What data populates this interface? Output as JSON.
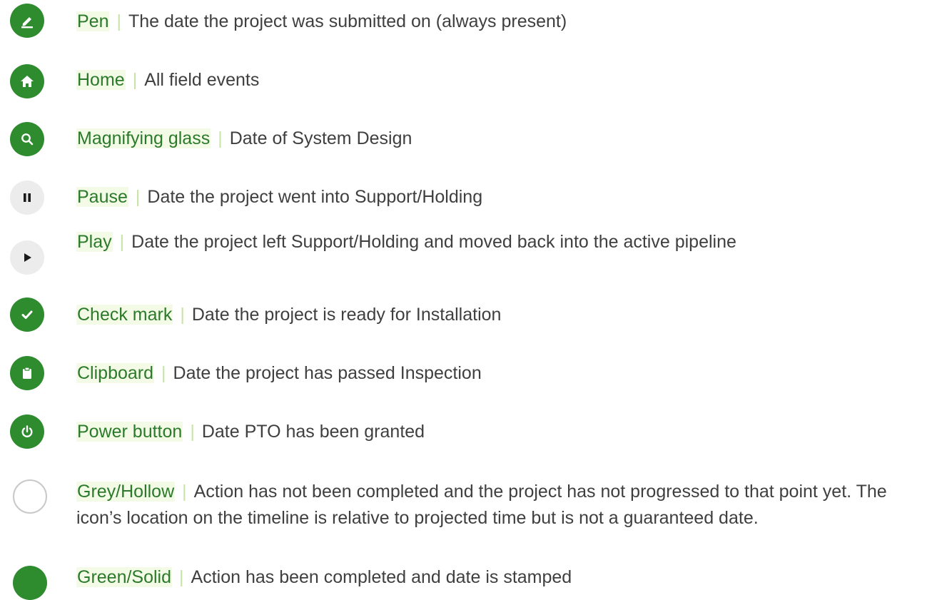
{
  "colors": {
    "accent_green": "#2e8b2e",
    "term_text": "#2b7a2b",
    "term_highlight": "#f3fbe6",
    "separator": "#c7e3a5",
    "body_text": "#3f3f3f",
    "grey_icon_bg": "#ececec",
    "hollow_border": "#c9c9c9"
  },
  "separator": "|",
  "legend": [
    {
      "icon": "pen-icon",
      "term": "Pen",
      "description": "The date the project was submitted on (always present)"
    },
    {
      "icon": "home-icon",
      "term": "Home",
      "description": "All field events"
    },
    {
      "icon": "magnifying-glass-icon",
      "term": "Magnifying glass",
      "description": "Date of System Design"
    },
    {
      "icon": "pause-icon",
      "term": "Pause",
      "description": "Date the project went into Support/Holding"
    },
    {
      "icon": "play-icon",
      "term": "Play",
      "description": "Date the project left Support/Holding and moved back into the active pipeline"
    },
    {
      "icon": "check-mark-icon",
      "term": "Check mark",
      "description": "Date the project is ready for Installation"
    },
    {
      "icon": "clipboard-icon",
      "term": "Clipboard",
      "description": "Date the project has passed Inspection"
    },
    {
      "icon": "power-button-icon",
      "term": "Power button",
      "description": "Date PTO has been granted"
    },
    {
      "icon": "hollow-circle-icon",
      "term": "Grey/Hollow",
      "description": "Action has not been completed and the project has not progressed to that point yet. The icon’s location on the timeline is relative to projected time but is not a guaranteed date."
    },
    {
      "icon": "solid-circle-icon",
      "term": "Green/Solid",
      "description": "Action has been completed and date is stamped"
    }
  ]
}
